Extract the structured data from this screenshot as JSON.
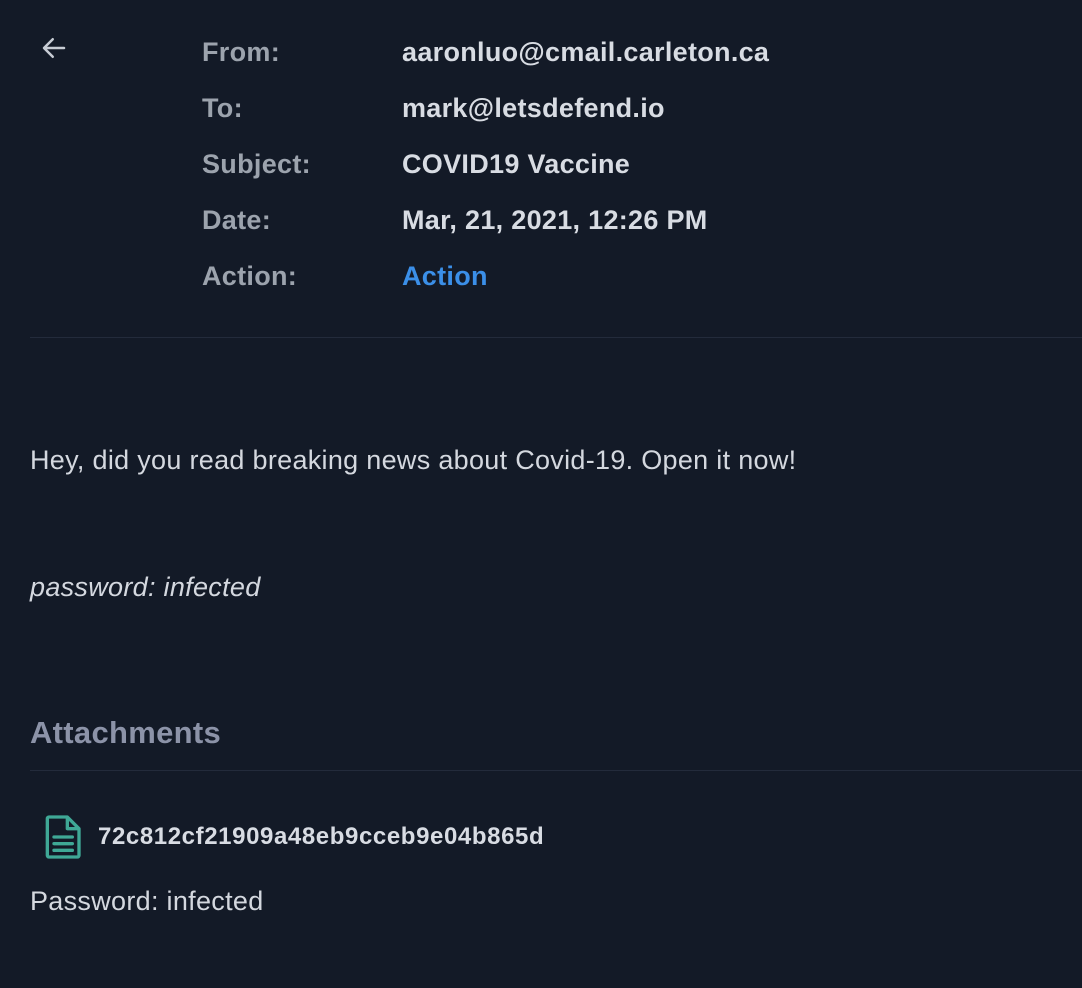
{
  "email": {
    "headers": [
      {
        "label": "From:",
        "value": "aaronluo@cmail.carleton.ca"
      },
      {
        "label": "To:",
        "value": "mark@letsdefend.io"
      },
      {
        "label": "Subject:",
        "value": "COVID19 Vaccine"
      },
      {
        "label": "Date:",
        "value": "Mar, 21, 2021, 12:26 PM"
      },
      {
        "label": "Action:",
        "value": "Action"
      }
    ],
    "body": {
      "message": "Hey, did you read breaking news about Covid-19. Open it now!",
      "password_note": "password: infected"
    },
    "attachments": {
      "title": "Attachments",
      "items": [
        {
          "name": "72c812cf21909a48eb9cceb9e04b865d",
          "icon": "file-text-icon"
        }
      ],
      "password_text": "Password: infected"
    }
  },
  "colors": {
    "background": "#131a27",
    "label": "#9ca3ad",
    "value": "#d8dce3",
    "link": "#3b8fe8",
    "section_title": "#8c93a8",
    "attachment_icon": "#3fa896",
    "divider": "#232b3b"
  }
}
